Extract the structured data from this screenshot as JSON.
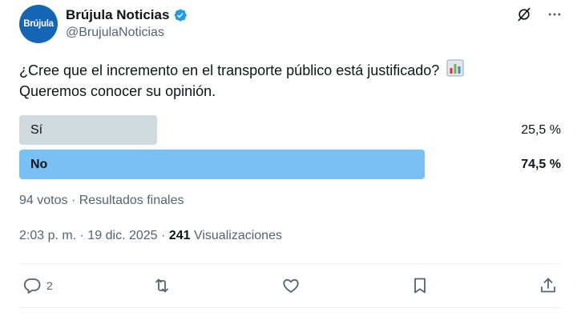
{
  "account": {
    "avatar_text": "Brújula",
    "display_name": "Brújula Noticias",
    "handle": "@BrujulaNoticias",
    "verified_color": "#1d9bf0",
    "avatar_color": "#1565b7"
  },
  "header_icons": [
    "grok-icon",
    "more-icon"
  ],
  "tweet": {
    "line1": "¿Cree que el incremento en el transporte público está justificado?",
    "line2": "Queremos conocer su opinión.",
    "emoji": "bar-chart-emoji"
  },
  "poll": {
    "options": [
      {
        "label": "Sí",
        "percent_text": "25,5 %",
        "percent": 25.5,
        "winner": false,
        "bar_color": "#cfd9de"
      },
      {
        "label": "No",
        "percent_text": "74,5 %",
        "percent": 74.5,
        "winner": true,
        "bar_color": "#79c1f5"
      }
    ],
    "votes": "94 votos",
    "separator": "·",
    "status": "Resultados finales"
  },
  "meta": {
    "time": "2:03 p. m.",
    "date": "19 dic. 2025",
    "separator": "·",
    "views_count": "241",
    "views_label": "Visualizaciones"
  },
  "actions": {
    "reply_count": "2",
    "icons": [
      "reply-icon",
      "repost-icon",
      "like-icon",
      "bookmark-icon",
      "share-icon"
    ]
  }
}
